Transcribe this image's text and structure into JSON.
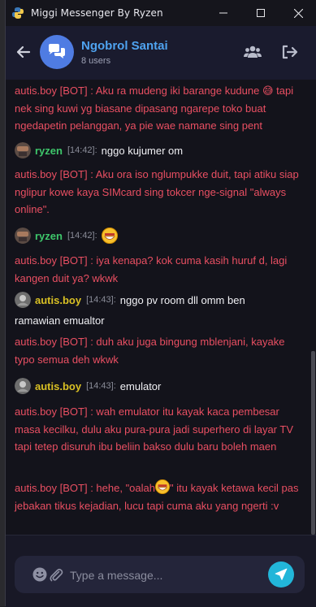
{
  "window": {
    "title": "Miggi Messenger By Ryzen"
  },
  "header": {
    "group_name": "Ngobrol Santai",
    "member_count": "8 users"
  },
  "messages": [
    {
      "type": "bot",
      "text": "autis.boy [BOT] : Aku ra mudeng iki barange kudune 😅 tapi nek sing kuwi yg biasane dipasang ngarepe toko buat ngedapetin pelanggan, ya pie wae namane sing pent"
    },
    {
      "type": "user",
      "name": "ryzen",
      "time": "[14:42]:",
      "text": "nggo kujumer om"
    },
    {
      "type": "bot",
      "text": "autis.boy [BOT] : Aku ora iso nglumpukke duit, tapi atiku siap nglipur kowe kaya SIMcard sing tokcer nge-signal \"always online\"."
    },
    {
      "type": "user",
      "name": "ryzen",
      "time": "[14:42]:",
      "text": ""
    },
    {
      "type": "bot",
      "text": "autis.boy [BOT] : iya kenapa? kok cuma kasih huruf d, lagi kangen duit ya? wkwk"
    },
    {
      "type": "user",
      "name": "autis.boy",
      "time": "[14:43]:",
      "text": "nggo pv room dll omm ben",
      "text_cont": "ramawian emualtor"
    },
    {
      "type": "bot",
      "text": "autis.boy [BOT] : duh aku juga bingung mblenjani, kayake typo semua deh wkwk"
    },
    {
      "type": "user",
      "name": "autis.boy",
      "time": "[14:43]:",
      "text": "emulator"
    },
    {
      "type": "bot",
      "text": "autis.boy [BOT] : wah emulator itu kayak kaca pembesar masa kecilku, dulu aku pura-pura jadi superhero di layar TV tapi tetep disuruh ibu beliin bakso dulu baru boleh maen"
    },
    {
      "type": "bot",
      "text_before": "autis.boy [BOT] : hehe, \"oalah",
      "text_after": "\" itu kayak ketawa kecil pas jebakan tikus kejadian, lucu tapi cuma aku yang ngerti :v"
    }
  ],
  "composer": {
    "placeholder": "Type a message..."
  },
  "colors": {
    "accent": "#4fa3f0",
    "bot_text": "#e94f62",
    "send_button": "#22b6d9",
    "user_green": "#3ec76b",
    "user_yellow": "#d9c024"
  },
  "icons": [
    "app-icon",
    "minimize-icon",
    "maximize-icon",
    "close-icon",
    "back-arrow-icon",
    "chat-bubbles-icon",
    "users-icon",
    "logout-icon",
    "emoji-icon",
    "attach-icon",
    "send-icon",
    "grinning-emoji"
  ]
}
